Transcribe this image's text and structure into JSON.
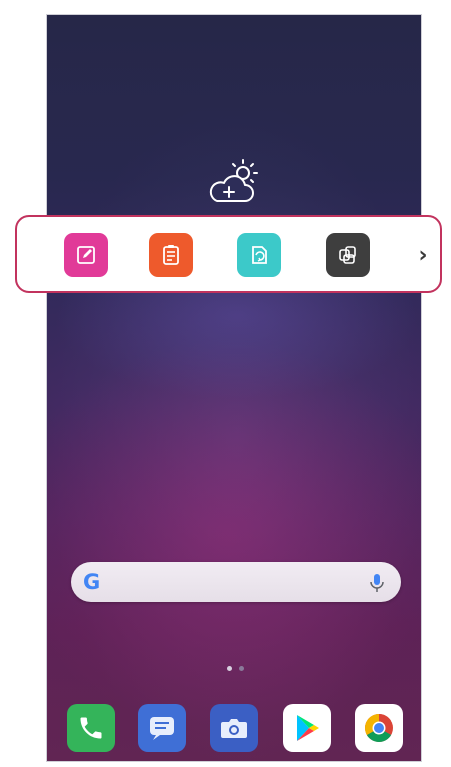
{
  "widgets": {
    "weather": {
      "icon": "cloud-sun-add-icon"
    }
  },
  "app_tray": {
    "highlight_color": "#c2335e",
    "apps": [
      {
        "icon": "memo-icon",
        "color": "#e13a98"
      },
      {
        "icon": "tasks-icon",
        "color": "#ee5a2c"
      },
      {
        "icon": "quick-memo-icon",
        "color": "#3cc9c9"
      },
      {
        "icon": "capture-icon",
        "color": "#3e3e3e"
      }
    ],
    "more_arrow": "›"
  },
  "search": {
    "logo_letter": "G",
    "mic_icon": "mic-icon"
  },
  "page_indicator": {
    "pages": 2,
    "active": 0
  },
  "dock": {
    "apps": [
      {
        "icon": "phone-icon",
        "color": "#34b45a"
      },
      {
        "icon": "messages-icon",
        "color": "#3f6fd6"
      },
      {
        "icon": "camera-icon",
        "color": "#3b5fc4"
      },
      {
        "icon": "play-store-icon",
        "color": "#ffffff"
      },
      {
        "icon": "chrome-icon",
        "color": "#ffffff"
      }
    ]
  }
}
